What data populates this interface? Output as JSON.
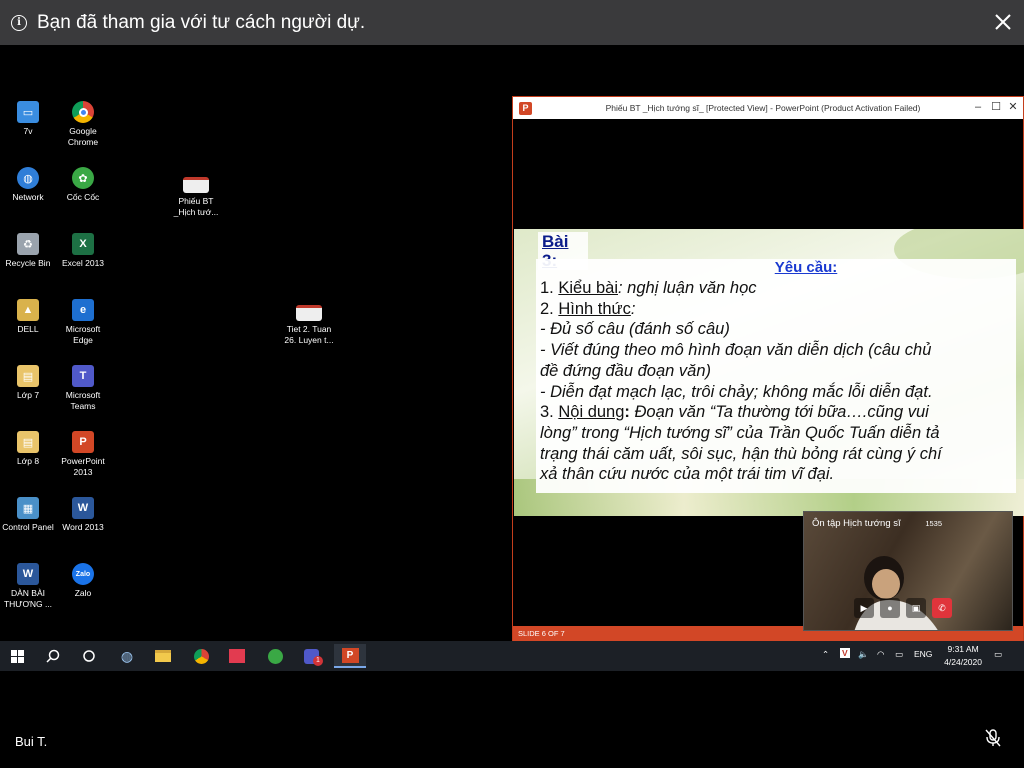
{
  "banner": {
    "message": "Bạn đã tham gia với tư cách người dự.",
    "info_icon": "info-icon",
    "close_icon": "close-icon"
  },
  "desktop_icons": [
    {
      "label": "7v",
      "icon": "computer-icon",
      "color": "#3a8de0"
    },
    {
      "label": "Google Chrome",
      "icon": "chrome-icon",
      "color": "#db4437"
    },
    {
      "label": "Network",
      "icon": "network-icon",
      "color": "#2f7ed8"
    },
    {
      "label": "Cốc Cốc",
      "icon": "coccoc-icon",
      "color": "#3aa845"
    },
    {
      "label": "Recycle Bin",
      "icon": "recycle-bin-icon",
      "color": "#9aa3ad"
    },
    {
      "label": "Excel 2013",
      "icon": "excel-icon",
      "color": "#1d7044"
    },
    {
      "label": "DELL",
      "icon": "user-folder-icon",
      "color": "#d9b24c"
    },
    {
      "label": "Microsoft Edge",
      "icon": "edge-icon",
      "color": "#1e6fd0"
    },
    {
      "label": "Lớp 7",
      "icon": "folder-icon",
      "color": "#e9c46a"
    },
    {
      "label": "Microsoft Teams",
      "icon": "teams-icon",
      "color": "#5059c9"
    },
    {
      "label": "Lớp 8",
      "icon": "folder-icon",
      "color": "#e9c46a"
    },
    {
      "label": "PowerPoint 2013",
      "icon": "powerpoint-icon",
      "color": "#d24726"
    },
    {
      "label": "Control Panel",
      "icon": "control-panel-icon",
      "color": "#4a90c8"
    },
    {
      "label": "Word 2013",
      "icon": "word-icon",
      "color": "#2b579a"
    },
    {
      "label": "DÀN BÀI THƯƠNG ...",
      "icon": "word-doc-icon",
      "color": "#2b579a"
    },
    {
      "label": "Zalo",
      "icon": "zalo-icon",
      "color": "#1a73e8"
    },
    {
      "label": "Phiếu BT _Hịch tướ...",
      "icon": "document-icon",
      "color": "#eeeeee"
    },
    {
      "label": "Tiet 2. Tuan 26. Luyen t...",
      "icon": "document-icon",
      "color": "#eeeeee"
    }
  ],
  "ppt": {
    "title": "Phiếu BT _Hịch tướng sĩ_ [Protected View] - PowerPoint (Product Activation Failed)",
    "minimize": "–",
    "maximize": "☐",
    "close": "✕",
    "slide_number": "SLIDE 6 OF 7",
    "slide": {
      "bai": "Bài 3:",
      "yeucau": "Yêu cầu:",
      "l1_num": "1. ",
      "l1_label": "Kiểu bài",
      "l1_text": ": nghị luận văn học",
      "l2_num": "2. ",
      "l2_label": "Hình thức",
      "l2_text": ":",
      "l3": "- Đủ số câu (đánh số câu)",
      "l4": "- Viết đúng theo mô hình đoạn văn diễn dịch (câu chủ",
      "l5": "đề đứng đầu đoạn văn)",
      "l6": "- Diễn đạt mạch lạc, trôi chảy; không mắc lỗi diễn đạt.",
      "l7_num": "3. ",
      "l7_label": "Nội dung",
      "l7_colon": ":",
      "l7_text": " Đoạn văn “Ta thường tới bữa….cũng vui",
      "l8": "lòng” trong “Hịch tướng sĩ” của Trần Quốc Tuấn diễn tả",
      "l9": "trạng thái căm uất, sôi sục, hận thù bỏng rát cùng ý chí",
      "l10": "xả thân cứu nước của một trái tim vĩ đại."
    }
  },
  "video": {
    "title": "Ôn tập Hịch tướng sĩ",
    "count": "1535"
  },
  "taskbar": {
    "lang": "ENG",
    "time": "9:31 AM",
    "date": "4/24/2020",
    "teams_badge": "1"
  },
  "participant": {
    "name": "Bui T."
  }
}
